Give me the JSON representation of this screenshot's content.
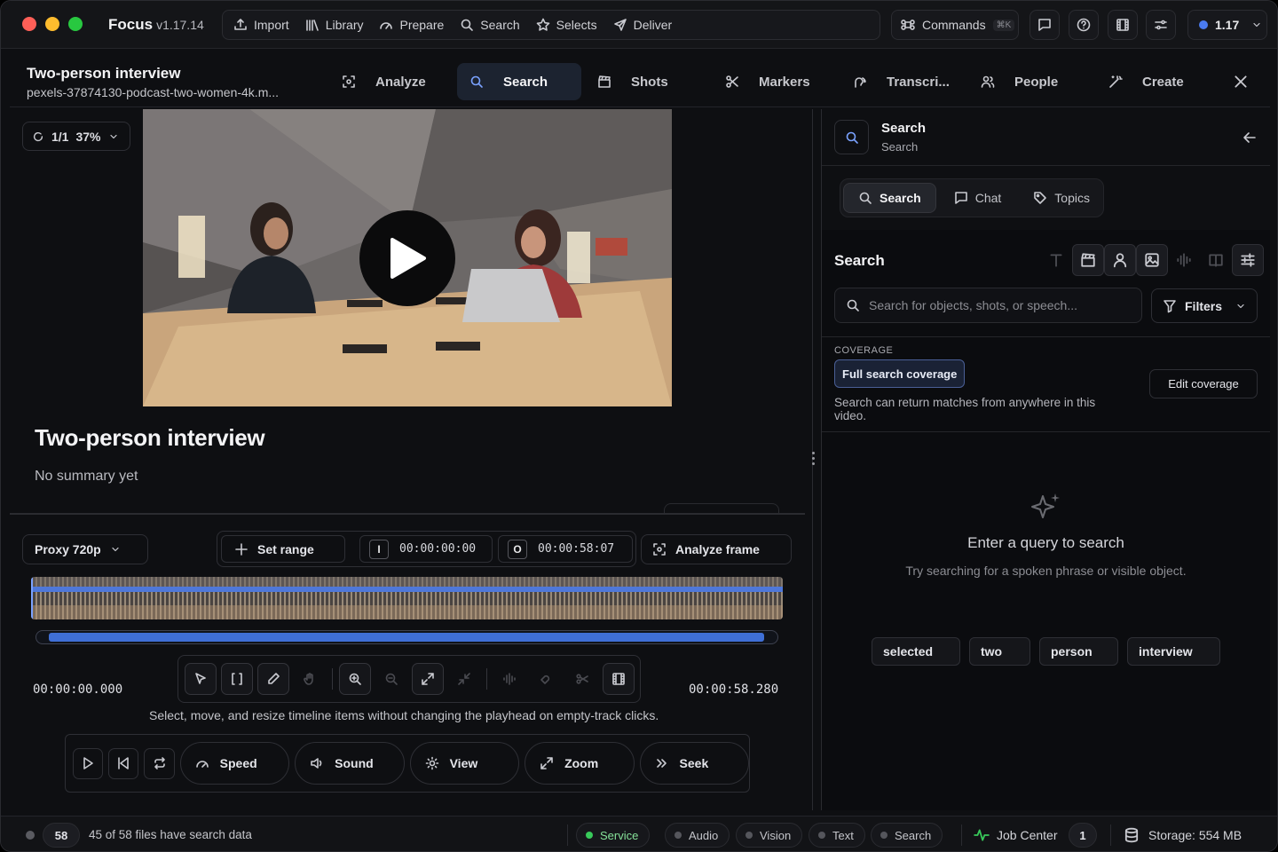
{
  "app": {
    "name": "Focus",
    "version": "v1.17.14",
    "nav": [
      {
        "label": "Import",
        "icon": "upload-icon"
      },
      {
        "label": "Library",
        "icon": "library-icon"
      },
      {
        "label": "Prepare",
        "icon": "gauge-icon"
      },
      {
        "label": "Search",
        "icon": "search-icon"
      },
      {
        "label": "Selects",
        "icon": "star-icon"
      },
      {
        "label": "Deliver",
        "icon": "send-icon"
      }
    ],
    "commands_label": "Commands",
    "commands_shortcut": "⌘K",
    "version_badge": "1.17",
    "colors": {
      "accent": "#4a7bf0",
      "status_ok": "#38c95a",
      "close": "#ff5f57",
      "minimize": "#febc2e",
      "zoom": "#28c840"
    }
  },
  "header": {
    "title": "Two-person interview",
    "filename": "pexels-37874130-podcast-two-women-4k.m...",
    "tabs": [
      {
        "label": "Analyze",
        "icon": "scan-icon"
      },
      {
        "label": "Search",
        "icon": "search-icon",
        "active": true
      },
      {
        "label": "Shots",
        "icon": "clapper-icon"
      },
      {
        "label": "Markers",
        "icon": "scissors-icon"
      },
      {
        "label": "Transcri...",
        "icon": "speaker-icon"
      },
      {
        "label": "People",
        "icon": "people-icon"
      },
      {
        "label": "Create",
        "icon": "wand-icon"
      }
    ]
  },
  "viewer": {
    "zoom_label": "1/1",
    "zoom_percent": "37%",
    "title": "Two-person interview",
    "summary": "No summary yet"
  },
  "controls": {
    "proxy": "Proxy 720p",
    "set_range": "Set range",
    "in_marker": "I",
    "in_time": "00:00:00:00",
    "out_marker": "O",
    "out_time": "00:00:58:07",
    "analyze_frame": "Analyze frame",
    "time_start": "00:00:00.000",
    "time_end": "00:00:58.280",
    "hint": "Select, move, and resize timeline items without changing the playhead on empty-track clicks.",
    "transport": [
      {
        "label": "Speed",
        "icon": "speed-icon"
      },
      {
        "label": "Sound",
        "icon": "volume-icon"
      },
      {
        "label": "View",
        "icon": "sun-icon"
      },
      {
        "label": "Zoom",
        "icon": "expand-icon"
      },
      {
        "label": "Seek",
        "icon": "fast-forward-icon"
      }
    ]
  },
  "panel": {
    "title": "Search",
    "subtitle": "Search",
    "segments": [
      {
        "label": "Search",
        "active": true
      },
      {
        "label": "Chat"
      },
      {
        "label": "Topics"
      }
    ],
    "search_title": "Search",
    "search_placeholder": "Search for objects, shots, or speech...",
    "filters_label": "Filters",
    "coverage_label": "COVERAGE",
    "coverage_badge": "Full search coverage",
    "edit_coverage": "Edit coverage",
    "coverage_desc": "Search can return matches from anywhere in this video.",
    "empty_title": "Enter a query to search",
    "empty_sub": "Try searching for a spoken phrase or visible object.",
    "suggestions": [
      "selected",
      "two",
      "person",
      "interview"
    ]
  },
  "status": {
    "file_count": "58",
    "files_text": "45 of 58 files have search data",
    "services": [
      {
        "label": "Service",
        "on": true
      },
      {
        "label": "Audio"
      },
      {
        "label": "Vision"
      },
      {
        "label": "Text"
      },
      {
        "label": "Search"
      }
    ],
    "job_center": "Job Center",
    "job_count": "1",
    "storage": "Storage: 554 MB"
  }
}
